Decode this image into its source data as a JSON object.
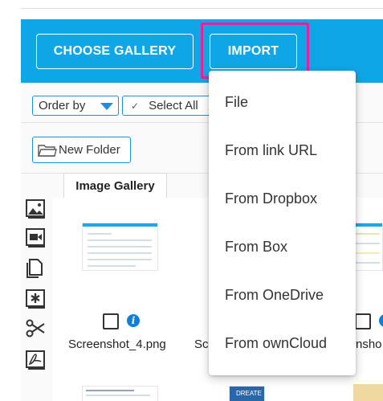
{
  "toolbar": {
    "choose_gallery_label": "CHOOSE GALLERY",
    "import_label": "IMPORT",
    "background_color": "#0fa6e8",
    "highlight_color": "#ee1f9a"
  },
  "filters": {
    "order_by_label": "Order by",
    "select_all_label": "Select All"
  },
  "new_folder_label": "New Folder",
  "gallery_tab_label": "Image Gallery",
  "side_tools": [
    "image-icon",
    "video-icon",
    "document-icon",
    "asterisk-icon",
    "scissors-icon",
    "pdf-icon"
  ],
  "files": [
    {
      "name": "Screenshot_4.png"
    },
    {
      "name": "Sc"
    },
    {
      "name": "nsho"
    }
  ],
  "import_menu": {
    "items": [
      "File",
      "From link URL",
      "From Dropbox",
      "From Box",
      "From OneDrive",
      "From ownCloud"
    ]
  },
  "bottom_thumb_label": "DREATE"
}
